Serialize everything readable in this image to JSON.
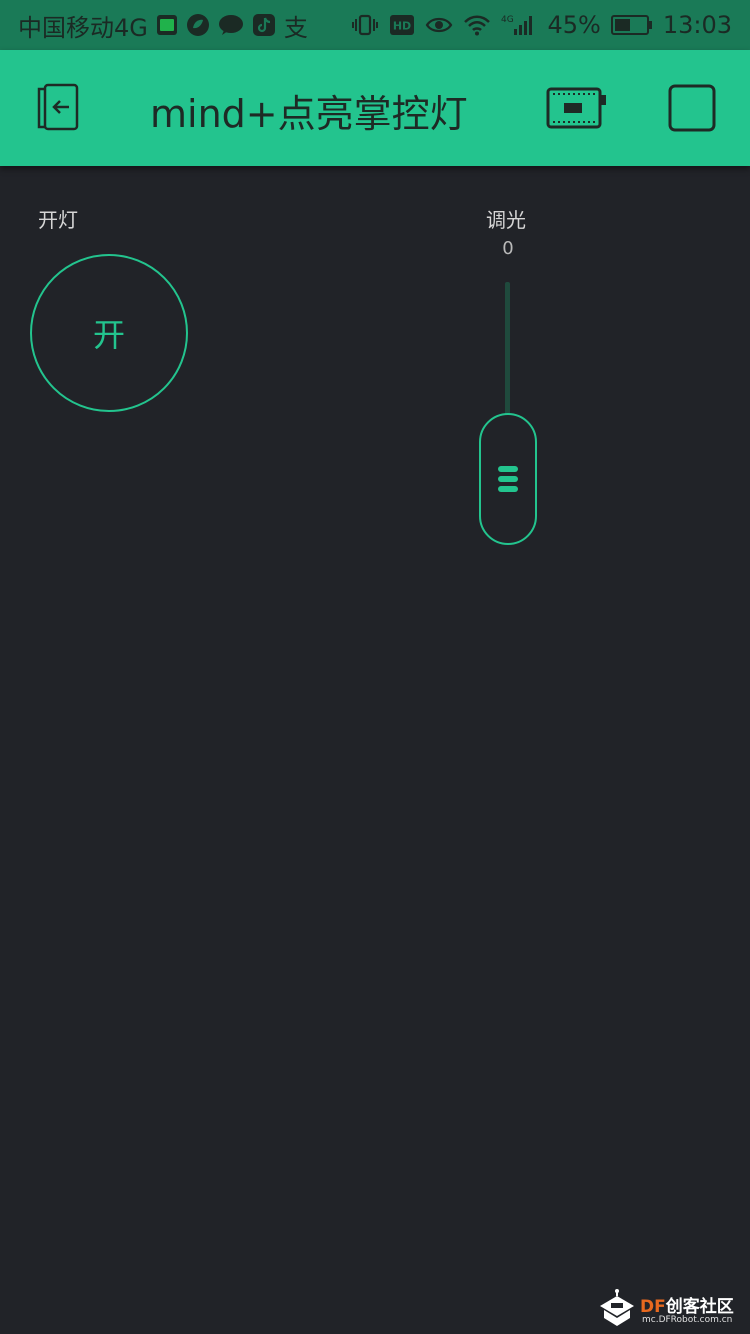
{
  "status_bar": {
    "carrier": "中国移动4G",
    "battery_percent": "45%",
    "time": "13:03",
    "network_type": "4G",
    "left_icons": [
      "iqiyi-icon",
      "leaf-icon",
      "chat-bubble-icon",
      "tiktok-icon",
      "alipay-icon"
    ],
    "right_icons": [
      "vibrate-icon",
      "hd-icon",
      "eye-icon",
      "wifi-icon",
      "signal-icon",
      "battery-icon"
    ],
    "hd_label": "HD",
    "alipay_glyph": "支"
  },
  "app_bar": {
    "title": "mind+点亮掌控灯",
    "icons": [
      "exit-icon",
      "device-board-icon",
      "stop-square-icon"
    ]
  },
  "widgets": {
    "button": {
      "label": "开灯",
      "text": "开",
      "state": "off"
    },
    "slider": {
      "label": "调光",
      "value": "0",
      "level": 0
    }
  },
  "watermark": {
    "brand_df": "DF",
    "brand_rest": "创客社区",
    "url": "mc.DFRobot.com.cn"
  },
  "colors": {
    "accent": "#23c48e",
    "background": "#212328",
    "status_bar": "#1a7a57"
  }
}
